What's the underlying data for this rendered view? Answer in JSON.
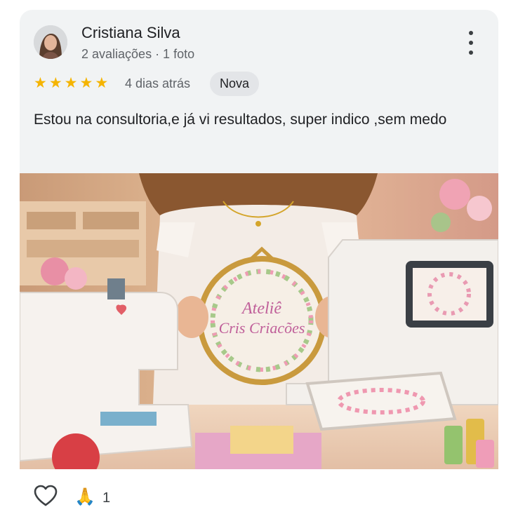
{
  "review": {
    "author_name": "Cristiana Silva",
    "author_meta": "2 avaliações · 1 foto",
    "rating": 5,
    "date": "4 dias atrás",
    "badge": "Nova",
    "text": "Estou na consultoria,e já vi resultados, super indico ,sem medo"
  },
  "photo": {
    "lines": [
      "Ateliê",
      "Cris Criacões"
    ]
  },
  "actions": {
    "like_icon": "heart-outline-icon",
    "reaction_icon": "folded-hands-emoji",
    "reaction_glyph": "🙏",
    "reaction_count": "1"
  },
  "colors": {
    "card_bg": "#f1f3f4",
    "star": "#f5b400",
    "badge_bg": "#e3e5e8",
    "photo_text": "#c0609a"
  }
}
